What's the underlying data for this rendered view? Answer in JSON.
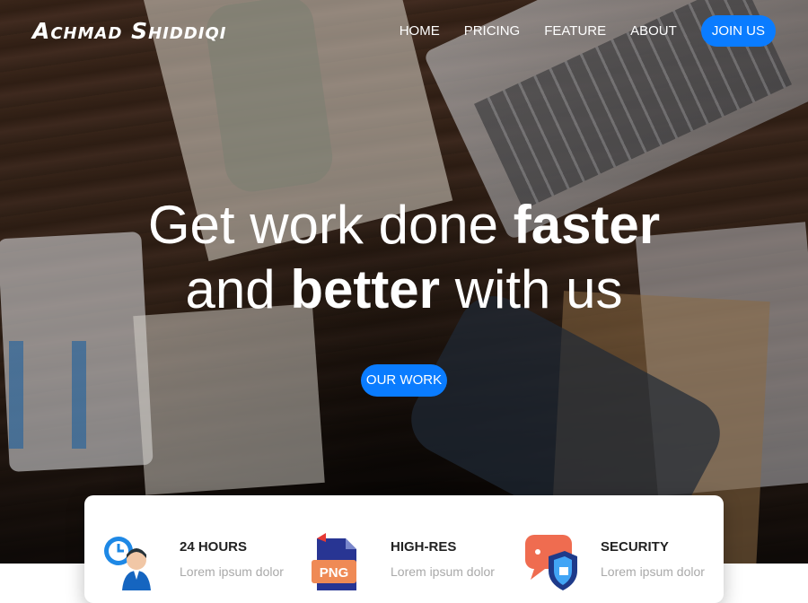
{
  "brand": {
    "name": "Achmad Shiddiqi"
  },
  "nav": {
    "links": [
      "HOME",
      "PRICING",
      "FEATURE",
      "ABOUT"
    ],
    "join_label": "JOIN US"
  },
  "hero": {
    "line1_light": "Get work done ",
    "line1_bold": "faster",
    "line2_light_a": "and ",
    "line2_bold": "better",
    "line2_light_b": " with us",
    "cta_label": "OUR WORK"
  },
  "features": [
    {
      "title": "24 HOURS",
      "text": "Lorem ipsum dolor",
      "icon": "clock-person-icon"
    },
    {
      "title": "HIGH-RES",
      "text": "Lorem ipsum dolor",
      "icon": "png-file-icon"
    },
    {
      "title": "SECURITY",
      "text": "Lorem ipsum dolor",
      "icon": "shield-chat-icon"
    }
  ],
  "icon_text": {
    "png": "PNG"
  },
  "colors": {
    "accent": "#0a7cff",
    "muted_text": "#a9a9a9"
  }
}
